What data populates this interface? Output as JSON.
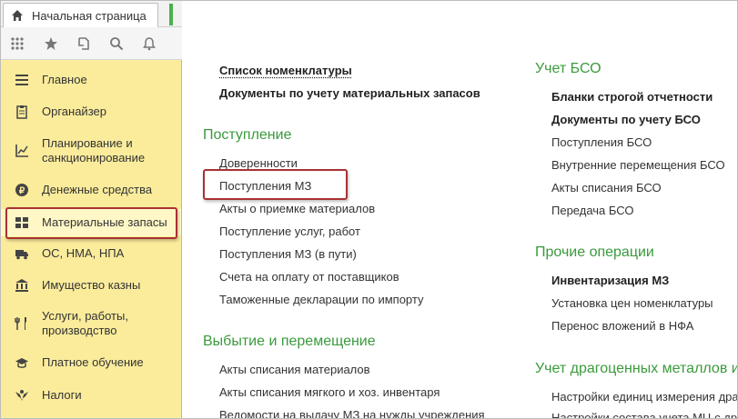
{
  "header": {
    "home_tab": "Начальная страница"
  },
  "toolbar": {
    "icons": [
      "apps-grid-icon",
      "star-icon",
      "history-icon",
      "search-icon",
      "bell-icon"
    ]
  },
  "sidebar": {
    "items": [
      {
        "label": "Главное",
        "icon": "menu-lines-icon"
      },
      {
        "label": "Органайзер",
        "icon": "clipboard-icon"
      },
      {
        "label": "Планирование и\nсанкционирование",
        "icon": "chart-icon"
      },
      {
        "label": "Денежные средства",
        "icon": "coin-icon"
      },
      {
        "label": "Материальные запасы",
        "icon": "boxes-icon",
        "selected": true
      },
      {
        "label": "ОС, НМА, НПА",
        "icon": "truck-icon"
      },
      {
        "label": "Имущество казны",
        "icon": "building-icon"
      },
      {
        "label": "Услуги, работы,\nпроизводство",
        "icon": "tools-icon"
      },
      {
        "label": "Платное обучение",
        "icon": "graduation-icon"
      },
      {
        "label": "Налоги",
        "icon": "eagle-icon"
      }
    ]
  },
  "main": {
    "top_links": [
      "Список номенклатуры",
      "Документы по учету материальных запасов"
    ],
    "sections_left": [
      {
        "title": "Поступление",
        "links": [
          "Доверенности",
          "Поступления МЗ",
          "Акты о приемке материалов",
          "Поступление услуг, работ",
          "Поступления МЗ (в пути)",
          "Счета на оплату от поставщиков",
          "Таможенные декларации по импорту"
        ]
      },
      {
        "title": "Выбытие и перемещение",
        "links": [
          "Акты списания материалов",
          "Акты списания мягкого и хоз. инвентаря",
          "Ведомости на выдачу МЗ на нужды учреждения"
        ]
      }
    ],
    "sections_right": [
      {
        "title": "Учет БСО",
        "links": [
          "Бланки строгой отчетности",
          "Документы по учету БСО",
          "Поступления БСО",
          "Внутренние перемещения БСО",
          "Акты списания БСО",
          "Передача БСО"
        ]
      },
      {
        "title": "Прочие операции",
        "links": [
          "Инвентаризация МЗ",
          "Установка цен номенклатуры",
          "Перенос вложений в НФА"
        ]
      },
      {
        "title": "Учет драгоценных металлов и",
        "links": [
          "Настройки единиц измерения драго",
          "Настройки состава учета МЦ с драгоц"
        ]
      }
    ]
  },
  "colors": {
    "sidebar_bg": "#fbec9c",
    "section_title": "#3a9a3c",
    "highlight": "#a83232"
  }
}
